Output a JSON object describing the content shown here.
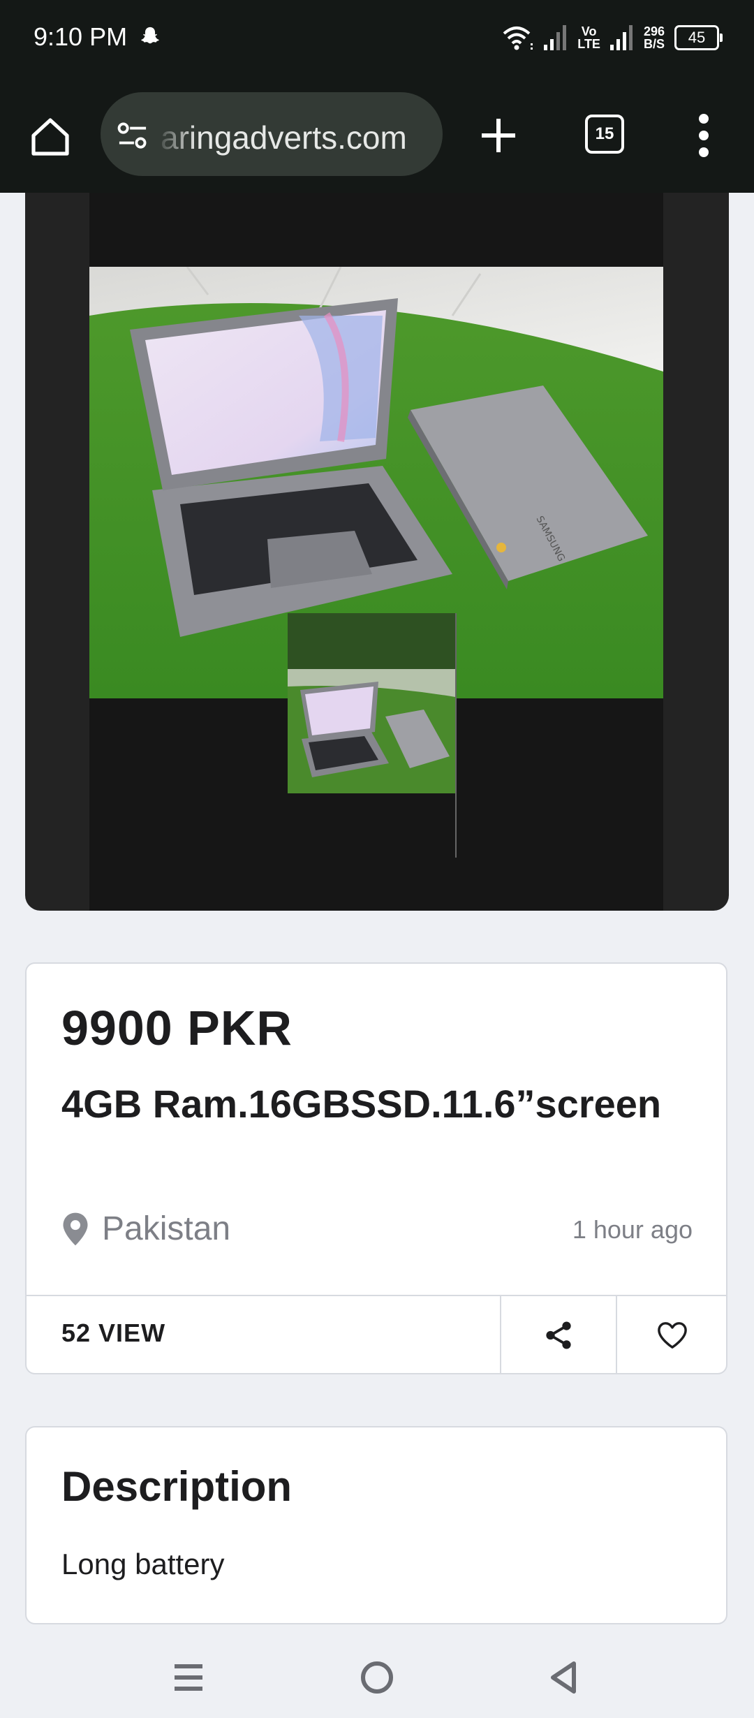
{
  "status_bar": {
    "time": "9:10 PM",
    "volte_top": "Vo",
    "volte_bottom": "LTE",
    "speed_value": "296",
    "speed_unit": "B/S",
    "battery": "45"
  },
  "browser": {
    "url": "aringadverts.com",
    "tab_count": "15"
  },
  "listing": {
    "price": "9900 PKR",
    "title": "4GB Ram.16GBSSD.11.6”screen",
    "location": "Pakistan",
    "posted": "1 hour ago",
    "views": "52 VIEW"
  },
  "description": {
    "heading": "Description",
    "body": "Long battery"
  },
  "icons": {
    "home": "home-icon",
    "site_info": "tune-icon",
    "new_tab": "plus-icon",
    "tabs": "tab-switcher-icon",
    "menu": "more-vert-icon",
    "location": "map-pin-icon",
    "share": "share-icon",
    "favorite": "heart-icon",
    "nav_recents": "menu-lines-icon",
    "nav_home": "circle-icon",
    "nav_back": "back-triangle-icon"
  },
  "colors": {
    "browser_bar": "#141816",
    "page_background": "#eef0f4",
    "text": "#1d1d1f",
    "muted_text": "#7d7f86"
  }
}
